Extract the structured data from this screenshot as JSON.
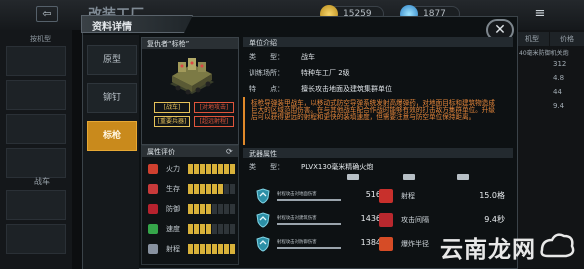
{
  "background": {
    "title": "改装工厂",
    "back_glyph": "⇦",
    "coins": "15259",
    "gems": "1877",
    "menu_glyph": "≡",
    "side_tag": "按机型",
    "side_label": "战车",
    "right_tabs": [
      "机型",
      "价格"
    ],
    "right_values": [
      "312",
      "4.8",
      "44",
      "9.4"
    ],
    "right_header": "40毫米防御机关炮"
  },
  "dialog": {
    "title": "资料详情",
    "close_glyph": "✕",
    "tabs": [
      "原型",
      "铆钉",
      "标枪"
    ],
    "active_tab": 2
  },
  "unit": {
    "header": "复仇者“标枪”",
    "badges": [
      {
        "text": "[战车]",
        "color": "#e7c25a"
      },
      {
        "text": "[对地攻击]",
        "color": "#e0553b"
      },
      {
        "text": "[重要兵器]",
        "color": "#e7c25a"
      },
      {
        "text": "[超远射程]",
        "color": "#e0553b"
      }
    ]
  },
  "stats": {
    "header": "属性评价",
    "refresh_glyph": "⟳",
    "rows": [
      {
        "label": "火力",
        "icon": "firepower-icon",
        "color": "#d0402f",
        "level": 8,
        "max": 8
      },
      {
        "label": "生存",
        "icon": "heart-icon",
        "color": "#c93a3a",
        "level": 6,
        "max": 8
      },
      {
        "label": "防御",
        "icon": "armor-icon",
        "color": "#b7222e",
        "level": 4,
        "max": 8
      },
      {
        "label": "速度",
        "icon": "speed-icon",
        "color": "#35a64a",
        "level": 4,
        "max": 8
      },
      {
        "label": "射程",
        "icon": "range-icon",
        "color": "#8892a0",
        "level": 8,
        "max": 8
      }
    ]
  },
  "info": {
    "header": "单位介绍",
    "rows": [
      {
        "key": "类　　型：",
        "value": "战车"
      },
      {
        "key": "训练场所：",
        "value": "特种车工厂 2级"
      },
      {
        "key": "特　　点：",
        "value": "擅长攻击地面及建筑集群单位"
      }
    ],
    "description": "标枪导弹装甲战车，以移动式防空导弹系统发射高爆弹药，对地面目标和建筑物造成巨大的区域范围伤害。在与其他战车配合作战时能够有效的打击敌方集群单位。升级后可以获得更远的射程和更快的装填速度，但需要注意与防空单位保持距离。"
  },
  "weapon": {
    "header": "武器属性",
    "type_key": "类　　型：",
    "type_value": "PLVX130毫米精确火炮",
    "damage_rows": [
      {
        "label": "射程攻击对地面伤害",
        "value": "516"
      },
      {
        "label": "射程攻击对建筑伤害",
        "value": "1436"
      },
      {
        "label": "射程攻击对防御伤害",
        "value": "1384"
      }
    ],
    "props": [
      {
        "label": "射程",
        "value": "15.0格",
        "icon": "range-icon",
        "color": "#c8302c"
      },
      {
        "label": "攻击间隔",
        "value": "9.4秒",
        "icon": "interval-icon",
        "color": "#b9282e"
      },
      {
        "label": "爆炸半径",
        "value": "",
        "icon": "blast-icon",
        "color": "#d64c26"
      }
    ]
  },
  "watermark": "云南龙网"
}
